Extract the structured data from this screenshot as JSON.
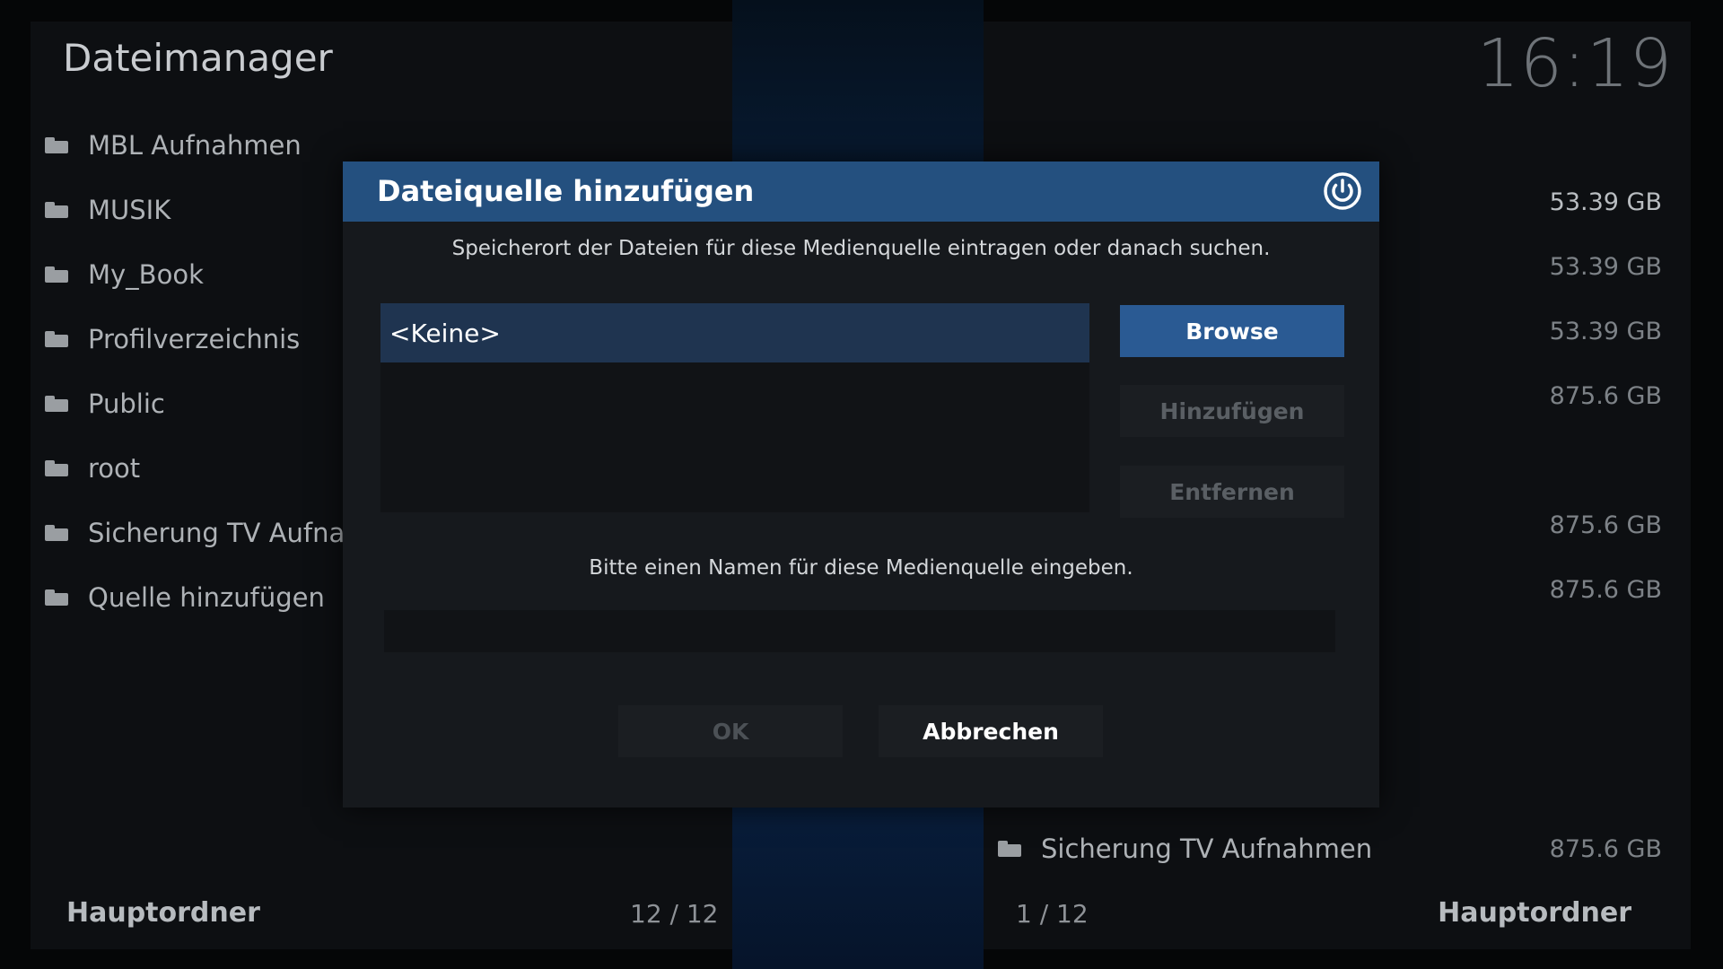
{
  "app": {
    "title": "Dateimanager",
    "clock": "16:19"
  },
  "left_list": {
    "items": [
      {
        "label": "MBL Aufnahmen",
        "icon": "folder-icon"
      },
      {
        "label": "MUSIK",
        "icon": "folder-icon"
      },
      {
        "label": "My_Book",
        "icon": "folder-icon"
      },
      {
        "label": "Profilverzeichnis",
        "icon": "folder-icon"
      },
      {
        "label": "Public",
        "icon": "folder-icon"
      },
      {
        "label": "root",
        "icon": "folder-icon"
      },
      {
        "label": "Sicherung TV Aufnahm",
        "icon": "folder-icon"
      },
      {
        "label": "Quelle hinzufügen",
        "icon": "folder-icon"
      }
    ]
  },
  "right_sizes": [
    "53.39 GB",
    "53.39 GB",
    "53.39 GB",
    "875.6 GB",
    "",
    "875.6 GB",
    "875.6 GB"
  ],
  "right_bottom_item": {
    "label": "Sicherung TV Aufnahmen",
    "size": "875.6 GB"
  },
  "footer": {
    "left_label": "Hauptordner",
    "left_count": "12 / 12",
    "right_count": "1 / 12",
    "right_label": "Hauptordner"
  },
  "dialog": {
    "title": "Dateiquelle hinzufügen",
    "description": "Speicherort der Dateien für diese Medienquelle eintragen oder danach suchen.",
    "path_items": [
      "<Keine>"
    ],
    "buttons": {
      "browse": "Browse",
      "add": "Hinzufügen",
      "remove": "Entfernen",
      "ok": "OK",
      "cancel": "Abbrechen"
    },
    "name_prompt": "Bitte einen Namen für diese Medienquelle eingeben.",
    "name_value": ""
  },
  "colors": {
    "header": "#24507f",
    "accent_button": "#2a5a93",
    "selected_item": "#1f3450"
  }
}
